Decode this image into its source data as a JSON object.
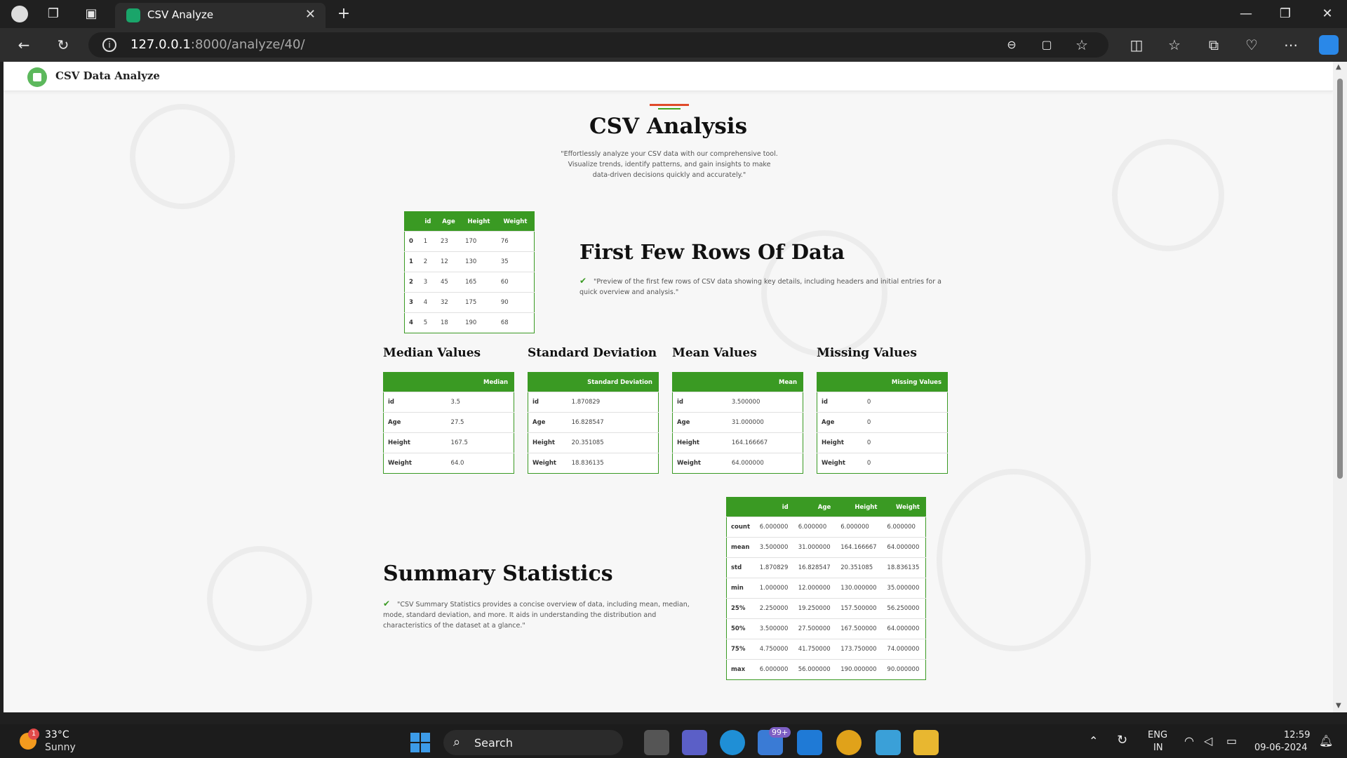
{
  "browser": {
    "tab_title": "CSV Analyze",
    "tab_close": "✕",
    "new_tab": "+",
    "url_host": "127.0.0.1",
    "url_path": ":8000/analyze/40/"
  },
  "app": {
    "brand": "CSV Data Analyze"
  },
  "hero": {
    "title": "CSV Analysis",
    "subtitle": "\"Effortlessly analyze your CSV data with our comprehensive tool. Visualize trends, identify patterns, and gain insights to make data-driven decisions quickly and accurately.\""
  },
  "first_rows": {
    "title": "First Few Rows Of Data",
    "description": "\"Preview of the first few rows of CSV data showing key details, including headers and initial entries for a quick overview and analysis.\"",
    "headers": [
      "",
      "id",
      "Age",
      "Height",
      "Weight"
    ],
    "rows": [
      [
        "0",
        "1",
        "23",
        "170",
        "76"
      ],
      [
        "1",
        "2",
        "12",
        "130",
        "35"
      ],
      [
        "2",
        "3",
        "45",
        "165",
        "60"
      ],
      [
        "3",
        "4",
        "32",
        "175",
        "90"
      ],
      [
        "4",
        "5",
        "18",
        "190",
        "68"
      ]
    ]
  },
  "median": {
    "title": "Median Values",
    "header": "Median",
    "rows": [
      [
        "id",
        "3.5"
      ],
      [
        "Age",
        "27.5"
      ],
      [
        "Height",
        "167.5"
      ],
      [
        "Weight",
        "64.0"
      ]
    ]
  },
  "std": {
    "title": "Standard Deviation",
    "header": "Standard Deviation",
    "rows": [
      [
        "id",
        "1.870829"
      ],
      [
        "Age",
        "16.828547"
      ],
      [
        "Height",
        "20.351085"
      ],
      [
        "Weight",
        "18.836135"
      ]
    ]
  },
  "mean": {
    "title": "Mean Values",
    "header": "Mean",
    "rows": [
      [
        "id",
        "3.500000"
      ],
      [
        "Age",
        "31.000000"
      ],
      [
        "Height",
        "164.166667"
      ],
      [
        "Weight",
        "64.000000"
      ]
    ]
  },
  "missing": {
    "title": "Missing Values",
    "header": "Missing Values",
    "rows": [
      [
        "id",
        "0"
      ],
      [
        "Age",
        "0"
      ],
      [
        "Height",
        "0"
      ],
      [
        "Weight",
        "0"
      ]
    ]
  },
  "summary": {
    "title": "Summary Statistics",
    "description": "\"CSV Summary Statistics provides a concise overview of data, including mean, median, mode, standard deviation, and more. It aids in understanding the distribution and characteristics of the dataset at a glance.\"",
    "headers": [
      "",
      "id",
      "Age",
      "Height",
      "Weight"
    ],
    "rows": [
      [
        "count",
        "6.000000",
        "6.000000",
        "6.000000",
        "6.000000"
      ],
      [
        "mean",
        "3.500000",
        "31.000000",
        "164.166667",
        "64.000000"
      ],
      [
        "std",
        "1.870829",
        "16.828547",
        "20.351085",
        "18.836135"
      ],
      [
        "min",
        "1.000000",
        "12.000000",
        "130.000000",
        "35.000000"
      ],
      [
        "25%",
        "2.250000",
        "19.250000",
        "157.500000",
        "56.250000"
      ],
      [
        "50%",
        "3.500000",
        "27.500000",
        "167.500000",
        "64.000000"
      ],
      [
        "75%",
        "4.750000",
        "41.750000",
        "173.750000",
        "74.000000"
      ],
      [
        "max",
        "6.000000",
        "56.000000",
        "190.000000",
        "90.000000"
      ]
    ]
  },
  "taskbar": {
    "weather_temp": "33°C",
    "weather_desc": "Sunny",
    "weather_badge": "1",
    "search_label": "Search",
    "badge_count": "99+",
    "lang1": "ENG",
    "lang2": "IN",
    "time": "12:59",
    "date": "09-06-2024"
  },
  "colors": {
    "accent_green": "#3a9a23",
    "accent_red": "#e04a2a"
  }
}
